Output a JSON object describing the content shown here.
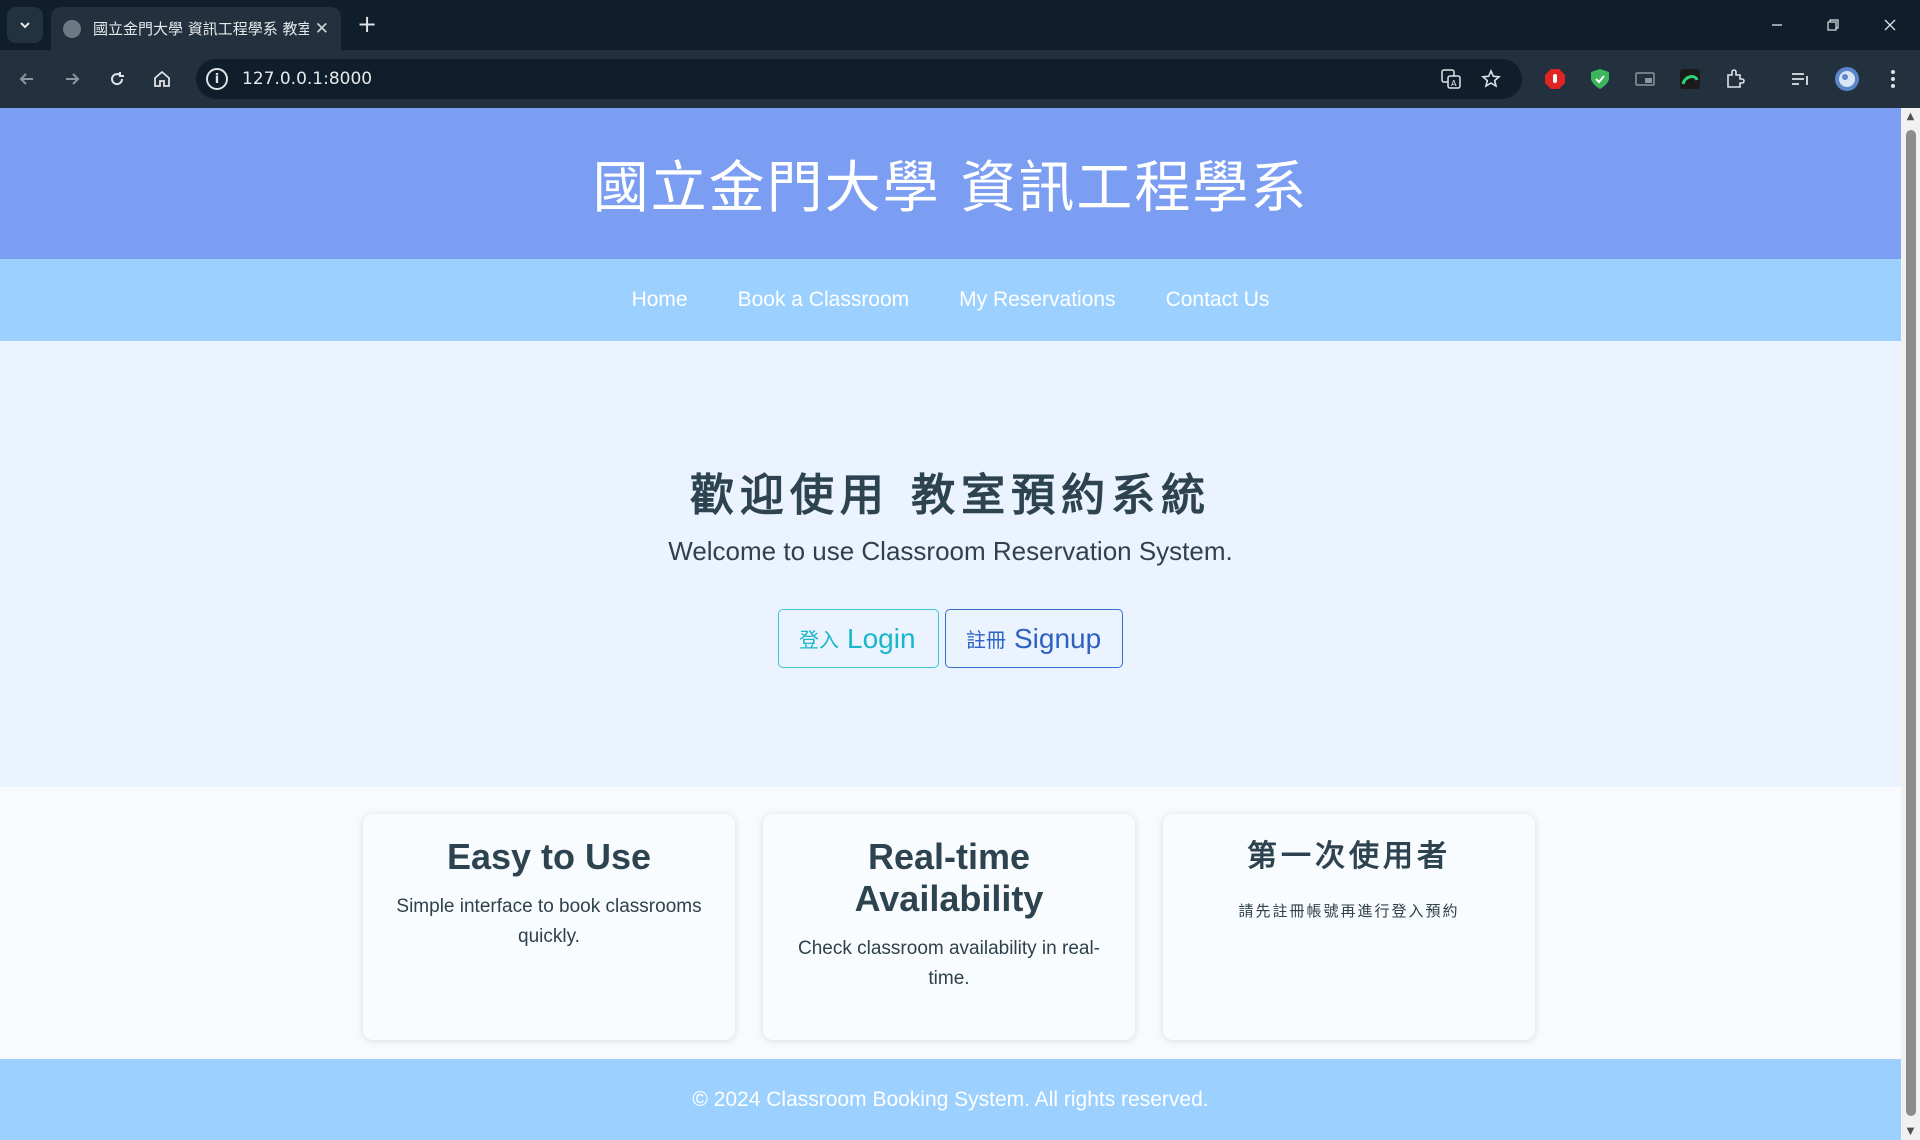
{
  "browser": {
    "tab_title": "國立金門大學 資訊工程學系 教室預約系統",
    "url": "127.0.0.1:8000",
    "new_tab_label": "+",
    "tab_close_label": "✕"
  },
  "site": {
    "header_title": "國立金門大學 資訊工程學系",
    "nav": [
      {
        "label": "Home"
      },
      {
        "label": "Book a Classroom"
      },
      {
        "label": "My Reservations"
      },
      {
        "label": "Contact Us"
      }
    ]
  },
  "hero": {
    "title": "歡迎使用 教室預約系統",
    "subtitle": "Welcome to use Classroom Reservation System.",
    "login_zh": "登入",
    "login_en": "Login",
    "signup_zh": "註冊",
    "signup_en": "Signup"
  },
  "features": [
    {
      "title": "Easy to Use",
      "text": "Simple interface to book classrooms quickly."
    },
    {
      "title": "Real-time Availability",
      "text": "Check classroom availability in real-time."
    },
    {
      "title": "第一次使用者",
      "text": "請先註冊帳號再進行登入預約"
    }
  ],
  "footer": {
    "text": "© 2024 Classroom Booking System. All rights reserved."
  },
  "colors": {
    "header_bg": "#7b9ef3",
    "nav_bg": "#9cd0ff",
    "hero_bg": "#eaf3fe",
    "login_accent": "#19b6cc",
    "signup_accent": "#2d62c4"
  }
}
